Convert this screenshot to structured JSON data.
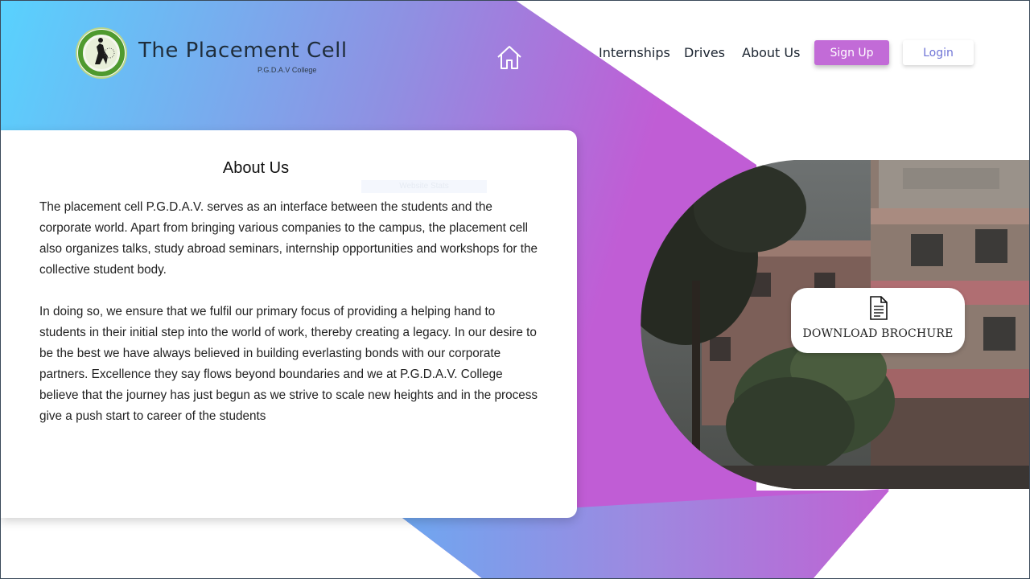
{
  "header": {
    "logo_name": "placement-cell-logo",
    "title": "The Placement Cell",
    "subtitle": "P.G.D.A.V College",
    "nav": [
      {
        "label": "Internships"
      },
      {
        "label": "Drives"
      },
      {
        "label": "About Us"
      }
    ],
    "signup_label": "Sign Up",
    "login_label": "Login"
  },
  "about": {
    "title": "About Us",
    "ghost_text": "Website Stats",
    "paragraph1": "The placement cell P.G.D.A.V. serves as an interface between the students and the corporate world. Apart from bringing various companies to the campus, the placement cell also organizes talks, study abroad seminars, internship opportunities and workshops for the collective student body.",
    "paragraph2": "In doing so, we ensure that we fulfil our primary focus of providing a helping hand to students in their initial step into the world of work, thereby creating a legacy. In our desire to be the best we have always believed in building everlasting bonds with our corporate partners. Excellence they say flows beyond boundaries and we at P.G.D.A.V. College believe that the journey has just begun as we strive to scale new heights and in the process give a push start to career of the students"
  },
  "brochure": {
    "label": "DOWNLOAD BROCHURE",
    "icon": "document-icon"
  },
  "colors": {
    "gradient_start": "#5cd3ff",
    "gradient_end": "#c85ed1",
    "signup": "#c26bd7",
    "login_text": "#6f74d6"
  }
}
